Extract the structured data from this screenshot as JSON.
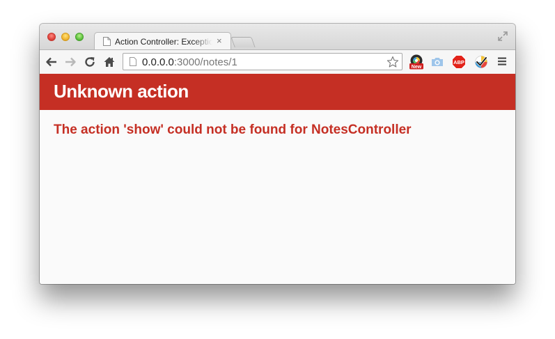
{
  "tab": {
    "title": "Action Controller: Exception caught",
    "close_glyph": "×"
  },
  "toolbar": {
    "url_host": "0.0.0.0",
    "url_rest": ":3000/notes/1"
  },
  "extensions": {
    "badge_new": "New",
    "abp_label": "ABP"
  },
  "icons": [
    "page-icon",
    "close-icon",
    "new-tab-icon",
    "fullscreen-icon",
    "back-arrow-icon",
    "forward-arrow-icon",
    "reload-icon",
    "home-icon",
    "star-icon",
    "camera-icon",
    "abp-icon",
    "checklist-icon",
    "menu-icon"
  ],
  "page": {
    "header_title": "Unknown action",
    "message": "The action 'show' could not be found for NotesController"
  },
  "colors": {
    "header_background": "#c52f24",
    "header_text": "#ffffff",
    "message_text": "#c52f24",
    "page_background": "#fafafa"
  }
}
